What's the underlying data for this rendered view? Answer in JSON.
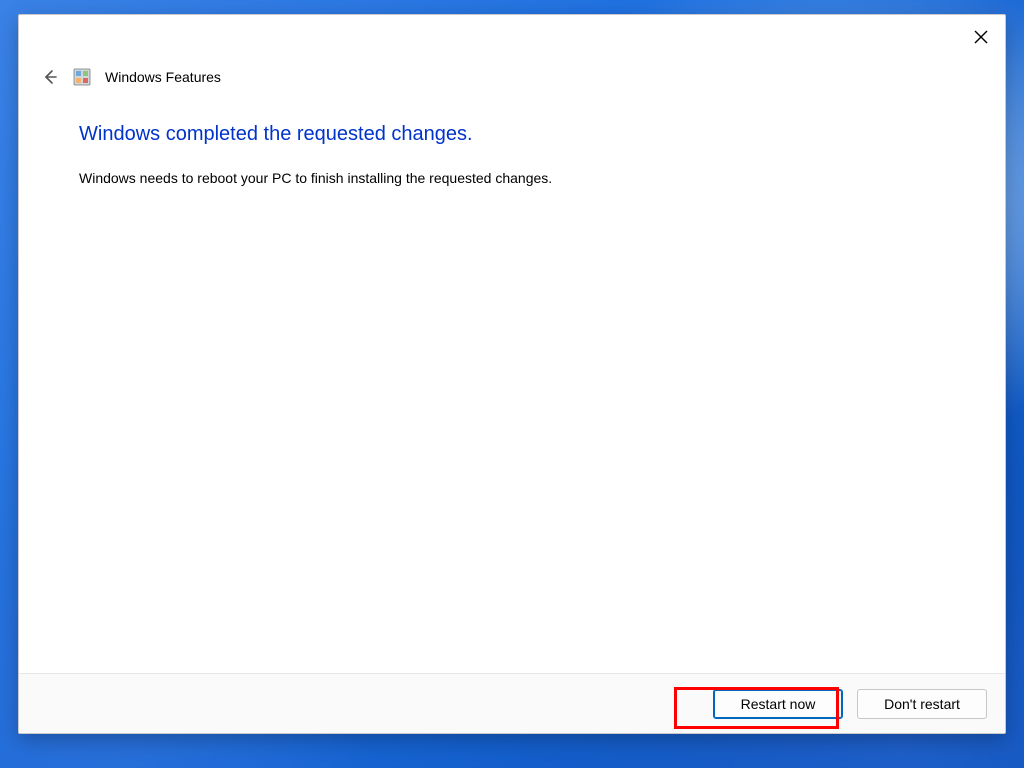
{
  "dialog": {
    "app_title": "Windows Features",
    "heading": "Windows completed the requested changes.",
    "body": "Windows needs to reboot your PC to finish installing the requested changes.",
    "buttons": {
      "restart": "Restart now",
      "dont_restart": "Don't restart"
    }
  }
}
